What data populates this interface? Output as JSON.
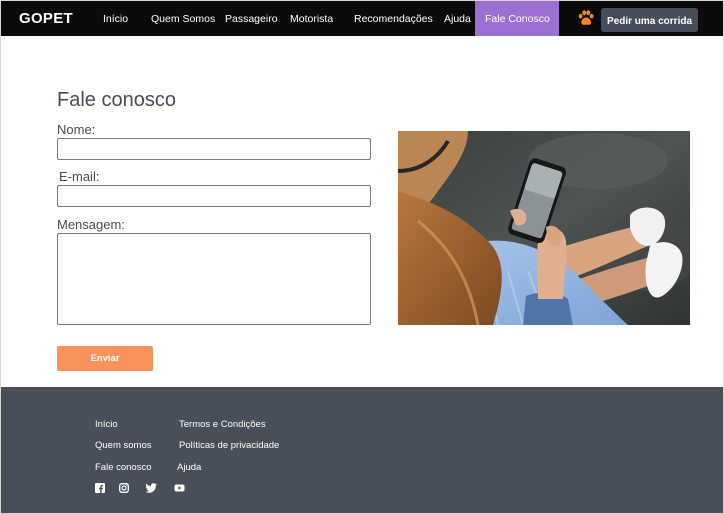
{
  "brand": "GOPET",
  "nav": {
    "items": [
      {
        "label": "Início"
      },
      {
        "label": "Quem Somos"
      },
      {
        "label": "Passageiro"
      },
      {
        "label": "Motorista"
      },
      {
        "label": "Recomendações"
      },
      {
        "label": "Ajuda"
      },
      {
        "label": "Fale Conosco",
        "active": true
      }
    ],
    "paw_icon": "paw-icon",
    "cta_label": "Pedir uma corrida"
  },
  "contact": {
    "title": "Fale conosco",
    "name_label": "Nome:",
    "name_value": "",
    "email_label": "E-mail:",
    "email_value": "",
    "message_label": "Mensagem:",
    "message_value": "",
    "submit_label": "Enviar"
  },
  "footer": {
    "col1": [
      "Início",
      "Quem somos",
      "Fale conosco"
    ],
    "col2": [
      "Termos e Condições",
      "Políticas de privacidade",
      "Ajuda"
    ],
    "social_icons": [
      "facebook-icon",
      "instagram-icon",
      "twitter-icon",
      "youtube-icon"
    ]
  },
  "colors": {
    "nav_bg": "#0b0b0b",
    "nav_active": "#9c6fd3",
    "accent_orange": "#f9925b",
    "paw": "#f0862e",
    "cta_bg": "#454e5a",
    "footer_bg": "#484f5a"
  }
}
